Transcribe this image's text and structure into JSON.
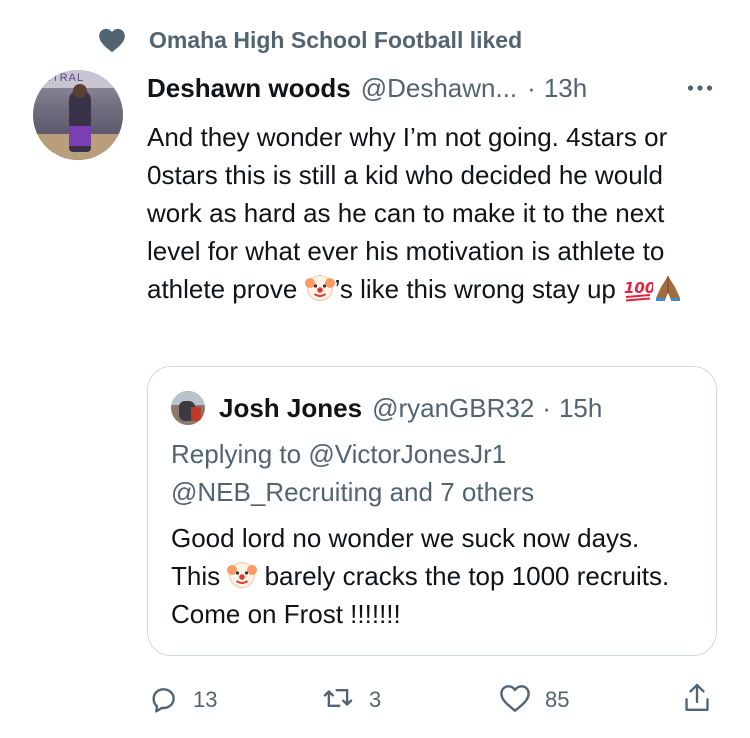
{
  "social_context": {
    "text": "Omaha High School Football liked"
  },
  "avatar": {
    "banner_text": "NTRAL"
  },
  "tweet": {
    "author_name": "Deshawn woods",
    "handle": "@Deshawn...",
    "dot": "·",
    "time": "13h",
    "text_part1": "And they wonder why I’m not going. 4stars or 0stars this is still a kid who decided he would work as hard as he can to make it to the next level for what ever his motivation is athlete to athlete prove ",
    "text_part2": "’s like this wrong stay up ",
    "emojis": [
      "clown-face",
      "hundred-points",
      "folded-hands"
    ]
  },
  "quote": {
    "author_name": "Josh Jones",
    "handle": "@ryanGBR32",
    "dot": "·",
    "time": "15h",
    "replying_prefix": "Replying to ",
    "replying_mention1": "@VictorJonesJr1",
    "replying_mention2": "@NEB_Recruiting",
    "replying_suffix": " and 7 others",
    "text_part1": "Good lord no wonder we suck now days.   This ",
    "text_part2": " barely cracks the top 1000 recruits.   Come on Frost !!!!!!!"
  },
  "actions": {
    "reply_count": "13",
    "retweet_count": "3",
    "like_count": "85"
  },
  "colors": {
    "text_primary": "#0f1419",
    "text_secondary": "#536471",
    "border": "#cfd9de",
    "accent": "#1d9bf0"
  },
  "icons": [
    "heart-icon",
    "more-icon",
    "reply-icon",
    "retweet-icon",
    "like-icon",
    "share-icon"
  ]
}
